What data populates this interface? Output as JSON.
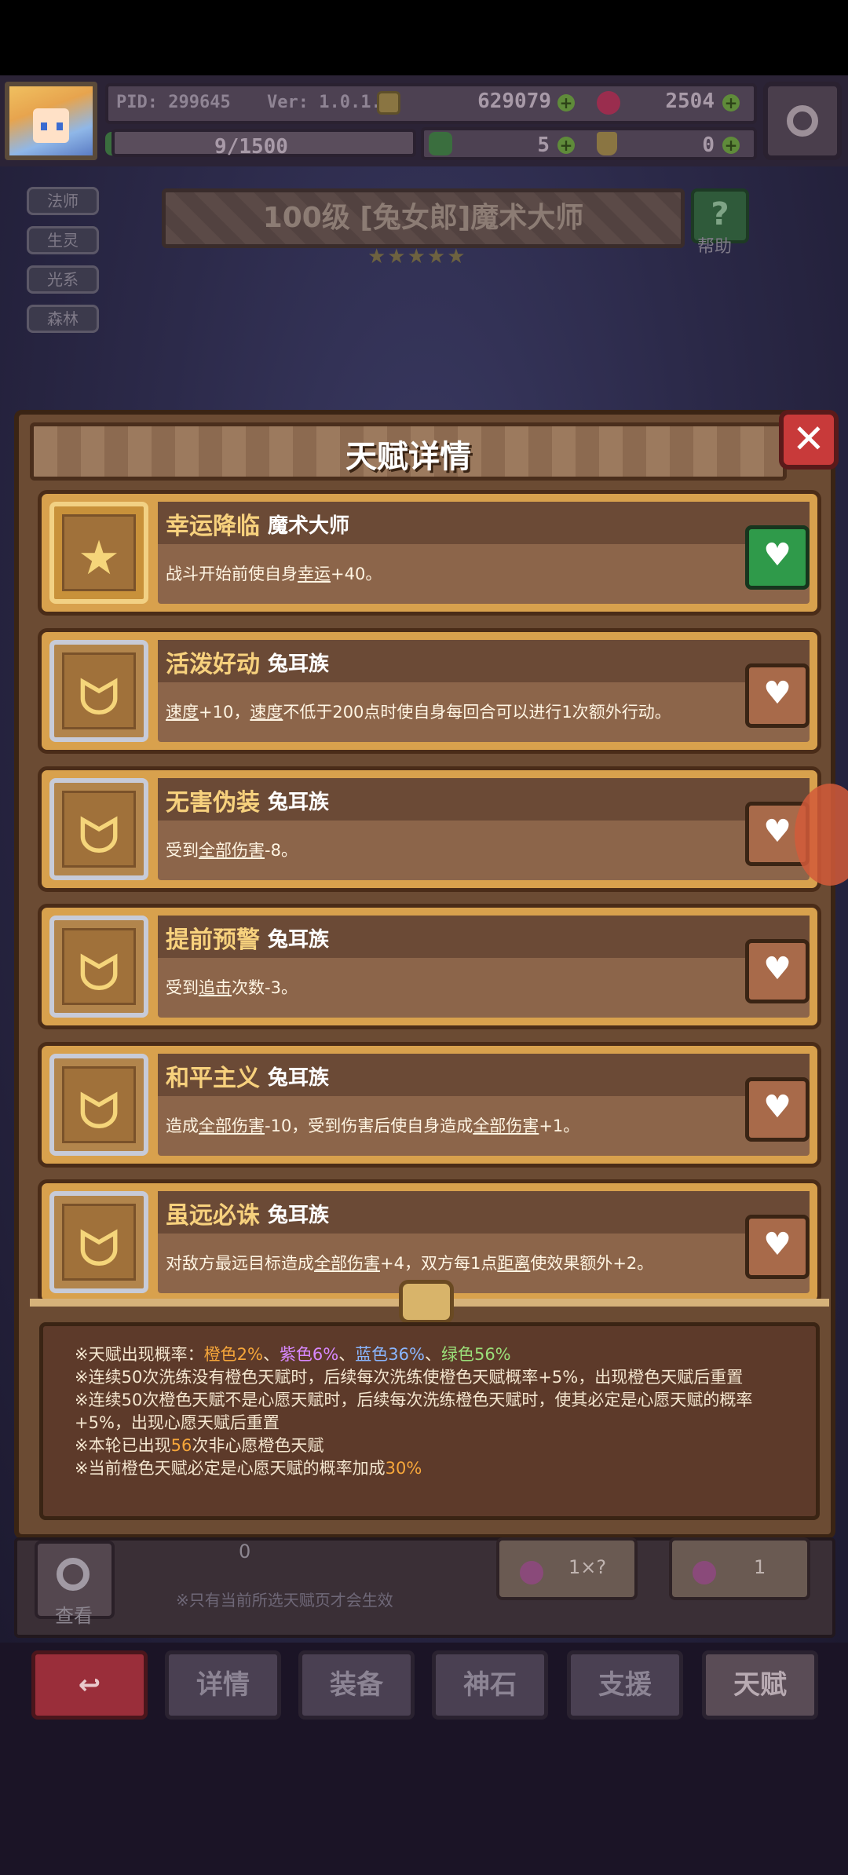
{
  "hud": {
    "pid": "PID: 299645",
    "version": "Ver: 1.0.1.3",
    "gold": "629079",
    "gems": "2504",
    "exp": "9/1500",
    "clovers": "5",
    "bags": "0"
  },
  "tags": [
    "法师",
    "生灵",
    "光系",
    "森林"
  ],
  "character": {
    "title": "100级 [兔女郎]魔术大师",
    "stars": "★★★★★",
    "help_label": "帮助"
  },
  "dialog": {
    "title": "天赋详情",
    "close_icon": "✕",
    "talents": [
      {
        "name": "幸运降临",
        "tribe": "魔术大师",
        "icon": "star-icon",
        "frame": "gold",
        "active": true,
        "desc": [
          "战斗开始前使自身",
          {
            "u": "幸运"
          },
          "+40。"
        ]
      },
      {
        "name": "活泼好动",
        "tribe": "兔耳族",
        "icon": "rabbit-icon",
        "frame": "silver",
        "active": false,
        "desc": [
          {
            "u": "速度"
          },
          "+10，",
          {
            "u": "速度"
          },
          "不低于200点时使自身每回合可以进行1次额外行动。"
        ]
      },
      {
        "name": "无害伪装",
        "tribe": "兔耳族",
        "icon": "rabbit-icon",
        "frame": "silver",
        "active": false,
        "desc": [
          "受到",
          {
            "u": "全部伤害"
          },
          "-8。"
        ]
      },
      {
        "name": "提前预警",
        "tribe": "兔耳族",
        "icon": "rabbit-icon",
        "frame": "silver",
        "active": false,
        "desc": [
          "受到",
          {
            "u": "追击"
          },
          "次数-3。"
        ]
      },
      {
        "name": "和平主义",
        "tribe": "兔耳族",
        "icon": "rabbit-icon",
        "frame": "silver",
        "active": false,
        "desc": [
          "造成",
          {
            "u": "全部伤害"
          },
          "-10，受到伤害后使自身造成",
          {
            "u": "全部伤害"
          },
          "+1。"
        ]
      },
      {
        "name": "虽远必诛",
        "tribe": "兔耳族",
        "icon": "rabbit-icon",
        "frame": "silver",
        "active": false,
        "desc": [
          "对敌方最远目标造成",
          {
            "u": "全部伤害"
          },
          "+4，双方每1点",
          {
            "u": "距离"
          },
          "使效果额外+2。"
        ]
      }
    ],
    "info": {
      "rate_prefix": "※天赋出现概率：",
      "orange": "橙色2%",
      "sep1": "、",
      "purple": "紫色6%",
      "sep2": "、",
      "blue": "蓝色36%",
      "sep3": "、",
      "green": "绿色56%",
      "line2": "※连续50次洗练没有橙色天赋时，后续每次洗练使橙色天赋概率+5%，出现橙色天赋后重置",
      "line3": "※连续50次橙色天赋不是心愿天赋时，后续每次洗练橙色天赋时，使其必定是心愿天赋的概率",
      "line4": "+5%，出现心愿天赋后重置",
      "line5_pre": "※本轮已出现",
      "line5_num": "56",
      "line5_post": "次非心愿橙色天赋",
      "line6_pre": "※当前橙色天赋必定是心愿天赋的概率加成",
      "line6_num": "30%"
    }
  },
  "lower": {
    "view_label": "查看",
    "count": "0",
    "note": "※只有当前所选天赋页才会生效",
    "reroll1": "1×?",
    "reroll2": "1"
  },
  "nav": [
    "详情",
    "装备",
    "神石",
    "支援",
    "天赋"
  ],
  "colors": {
    "orange": "#f6a63a",
    "purple": "#d888ff",
    "blue": "#8ab6ff",
    "green": "#9be07a"
  }
}
